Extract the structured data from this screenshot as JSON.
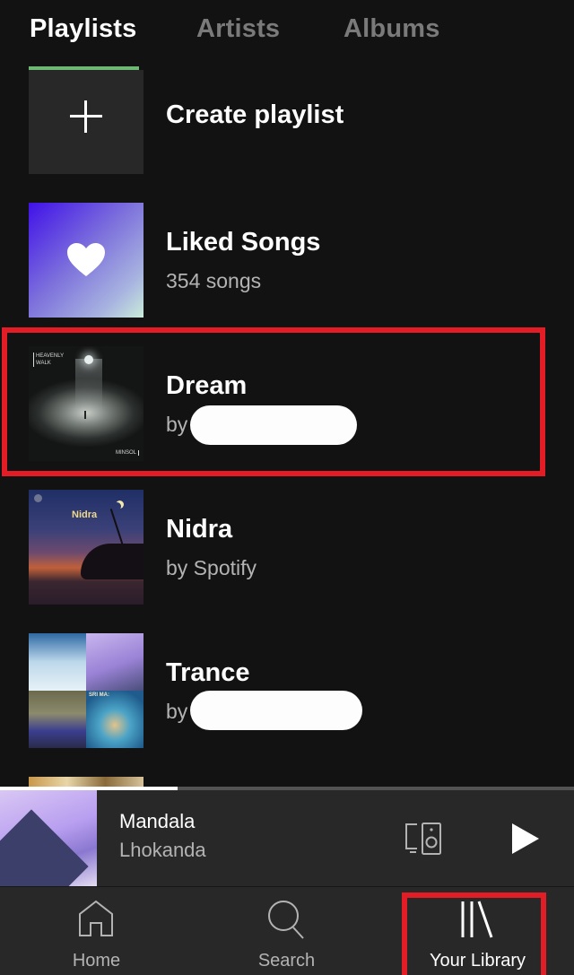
{
  "tabs": [
    {
      "label": "Playlists",
      "active": true
    },
    {
      "label": "Artists",
      "active": false
    },
    {
      "label": "Albums",
      "active": false
    }
  ],
  "colors": {
    "background": "#121212",
    "accent_green": "#6db872",
    "highlight_red": "#e31d25",
    "player_bg": "#282828",
    "secondary_text": "#b3b3b3"
  },
  "list": {
    "create": {
      "title": "Create playlist",
      "icon": "plus-icon"
    },
    "items": [
      {
        "title": "Liked Songs",
        "subtitle": "354 songs",
        "icon": "heart-icon"
      },
      {
        "title": "Dream",
        "subtitle_prefix": "by",
        "owner_redacted": true,
        "cover_text_top": "HEAVENLY WALK",
        "cover_text_bottom": "MINSOL",
        "highlighted": true
      },
      {
        "title": "Nidra",
        "subtitle": "by Spotify",
        "cover_text": "Nidra"
      },
      {
        "title": "Trance",
        "subtitle_prefix": "by",
        "owner_redacted": true,
        "cover_text": "SRI MA:"
      }
    ]
  },
  "player": {
    "song": "Mandala",
    "artist": "Lhokanda",
    "progress_percent": 31,
    "devices_icon": "devices-icon",
    "play_icon": "play-icon"
  },
  "nav": {
    "items": [
      {
        "label": "Home",
        "icon": "home-icon",
        "active": false
      },
      {
        "label": "Search",
        "icon": "search-icon",
        "active": false
      },
      {
        "label": "Your Library",
        "icon": "library-icon",
        "active": true,
        "highlighted": true
      }
    ]
  }
}
